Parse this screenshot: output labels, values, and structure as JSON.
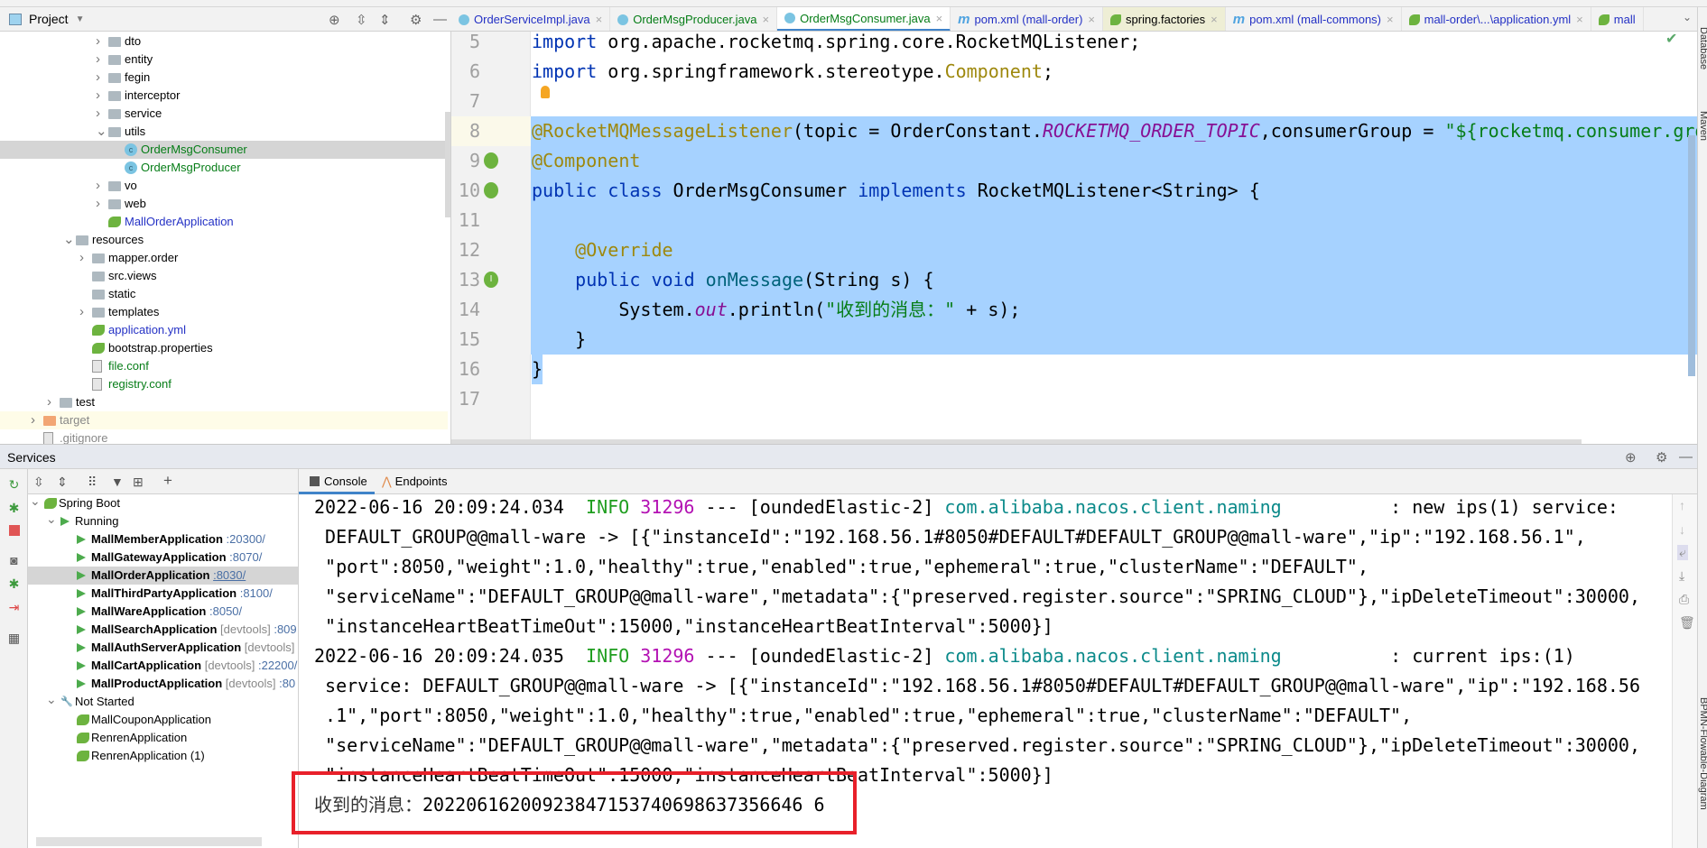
{
  "project": {
    "title": "Project",
    "tree": [
      {
        "label": "dto",
        "icon": "folder-icon",
        "arrow": "›",
        "depth": 6,
        "color": "black"
      },
      {
        "label": "entity",
        "icon": "folder-icon",
        "arrow": "›",
        "depth": 6,
        "color": "black"
      },
      {
        "label": "fegin",
        "icon": "folder-icon",
        "arrow": "›",
        "depth": 6,
        "color": "black"
      },
      {
        "label": "interceptor",
        "icon": "folder-icon",
        "arrow": "›",
        "depth": 6,
        "color": "black"
      },
      {
        "label": "service",
        "icon": "folder-icon",
        "arrow": "›",
        "depth": 6,
        "color": "black"
      },
      {
        "label": "utils",
        "icon": "folder-icon",
        "arrow": "⌄",
        "depth": 6,
        "color": "black"
      },
      {
        "label": "OrderMsgConsumer",
        "icon": "class-icon",
        "arrow": "",
        "depth": 7,
        "color": "green",
        "selected": true
      },
      {
        "label": "OrderMsgProducer",
        "icon": "class-icon",
        "arrow": "",
        "depth": 7,
        "color": "green"
      },
      {
        "label": "vo",
        "icon": "folder-icon",
        "arrow": "›",
        "depth": 6,
        "color": "black"
      },
      {
        "label": "web",
        "icon": "folder-icon",
        "arrow": "›",
        "depth": 6,
        "color": "black"
      },
      {
        "label": "MallOrderApplication",
        "icon": "spring-boot-class-icon",
        "arrow": "",
        "depth": 6,
        "color": "blue"
      },
      {
        "label": "resources",
        "icon": "resources-folder-icon",
        "arrow": "⌄",
        "depth": 4,
        "color": "black"
      },
      {
        "label": "mapper.order",
        "icon": "folder-icon",
        "arrow": "›",
        "depth": 5,
        "color": "black"
      },
      {
        "label": "src.views",
        "icon": "folder-icon",
        "arrow": "",
        "depth": 5,
        "color": "black"
      },
      {
        "label": "static",
        "icon": "folder-icon",
        "arrow": "",
        "depth": 5,
        "color": "black"
      },
      {
        "label": "templates",
        "icon": "folder-icon",
        "arrow": "›",
        "depth": 5,
        "color": "black"
      },
      {
        "label": "application.yml",
        "icon": "spring-config-icon",
        "arrow": "",
        "depth": 5,
        "color": "blue"
      },
      {
        "label": "bootstrap.properties",
        "icon": "spring-config-icon",
        "arrow": "",
        "depth": 5,
        "color": "black"
      },
      {
        "label": "file.conf",
        "icon": "text-file-icon",
        "arrow": "",
        "depth": 5,
        "color": "green"
      },
      {
        "label": "registry.conf",
        "icon": "text-file-icon",
        "arrow": "",
        "depth": 5,
        "color": "green"
      },
      {
        "label": "test",
        "icon": "folder-icon",
        "arrow": "›",
        "depth": 3,
        "color": "black"
      },
      {
        "label": "target",
        "icon": "excluded-folder-icon",
        "arrow": "›",
        "depth": 2,
        "color": "gray",
        "ignored": true
      },
      {
        "label": ".gitignore",
        "icon": "ignore-file-icon",
        "arrow": "",
        "depth": 2,
        "color": "gray"
      }
    ]
  },
  "tabs": [
    {
      "label": "OrderServiceImpl.java",
      "icon": "class-icon",
      "color": "#2431c5"
    },
    {
      "label": "OrderMsgProducer.java",
      "icon": "class-icon",
      "color": "#067d17"
    },
    {
      "label": "OrderMsgConsumer.java",
      "icon": "class-icon",
      "color": "#067d17",
      "active": true
    },
    {
      "label": "pom.xml (mall-order)",
      "icon": "maven-icon",
      "color": "#2431c5"
    },
    {
      "label": "spring.factories",
      "icon": "spring-icon",
      "color": "#000000",
      "highlighted": true
    },
    {
      "label": "pom.xml (mall-commons)",
      "icon": "maven-icon",
      "color": "#2431c5"
    },
    {
      "label": "mall-order\\...\\application.yml",
      "icon": "spring-icon",
      "color": "#2431c5"
    },
    {
      "label": "mall",
      "icon": "spring-icon",
      "color": "#2431c5"
    }
  ],
  "editor": {
    "selection": {
      "from_line": 8,
      "to_line": 16
    },
    "caret_line": 8,
    "lines": [
      {
        "n": "5",
        "tokens": [
          {
            "k": "kw",
            "t": "import"
          },
          {
            "k": "",
            "t": " org.apache.rocketmq.spring.core.RocketMQListener;"
          }
        ]
      },
      {
        "n": "6",
        "tokens": [
          {
            "k": "kw",
            "t": "import"
          },
          {
            "k": "",
            "t": " org.springframework.stereotype."
          },
          {
            "k": "ann",
            "t": "Component"
          },
          {
            "k": "",
            "t": ";"
          }
        ]
      },
      {
        "n": "7",
        "tokens": []
      },
      {
        "n": "8",
        "tokens": [
          {
            "k": "ann",
            "t": "@RocketMQMessageListener"
          },
          {
            "k": "",
            "t": "(topic = OrderConstant."
          },
          {
            "k": "static",
            "t": "ROCKETMQ_ORDER_TOPIC"
          },
          {
            "k": "",
            "t": ",consumerGroup = "
          },
          {
            "k": "str",
            "t": "\"${rocketmq.consumer.gro"
          }
        ]
      },
      {
        "n": "9",
        "tokens": [
          {
            "k": "ann",
            "t": "@Component"
          }
        ],
        "gutter": "spring-bean-icon"
      },
      {
        "n": "10",
        "tokens": [
          {
            "k": "kw",
            "t": "public class"
          },
          {
            "k": "",
            "t": " OrderMsgConsumer "
          },
          {
            "k": "kw",
            "t": "implements"
          },
          {
            "k": "",
            "t": " RocketMQListener<String> {"
          }
        ],
        "gutter": "spring-class-icon"
      },
      {
        "n": "11",
        "tokens": []
      },
      {
        "n": "12",
        "tokens": [
          {
            "k": "",
            "t": "    "
          },
          {
            "k": "ann",
            "t": "@Override"
          }
        ]
      },
      {
        "n": "13",
        "tokens": [
          {
            "k": "",
            "t": "    "
          },
          {
            "k": "kw",
            "t": "public void"
          },
          {
            "k": "",
            "t": " "
          },
          {
            "k": "fn",
            "t": "onMessage"
          },
          {
            "k": "",
            "t": "(String s) {"
          }
        ],
        "gutter": "implements-method-icon"
      },
      {
        "n": "14",
        "tokens": [
          {
            "k": "",
            "t": "        System."
          },
          {
            "k": "static",
            "t": "out"
          },
          {
            "k": "",
            "t": ".println("
          },
          {
            "k": "str",
            "t": "\"收到的消息：\""
          },
          {
            "k": "",
            "t": " + s);"
          }
        ]
      },
      {
        "n": "15",
        "tokens": [
          {
            "k": "",
            "t": "    }"
          }
        ]
      },
      {
        "n": "16",
        "tokens": [
          {
            "k": "",
            "t": "}"
          }
        ]
      },
      {
        "n": "17",
        "tokens": []
      }
    ]
  },
  "right_strip": [
    "Database",
    "Maven",
    "BPMN-Flowable-Diagram"
  ],
  "services": {
    "title": "Services",
    "tree": [
      {
        "label": "Spring Boot",
        "type": "group",
        "depth": 0
      },
      {
        "label": "Running",
        "type": "running-group",
        "depth": 1
      },
      {
        "label": "MallMemberApplication",
        "port": ":20300/",
        "type": "app",
        "depth": 2
      },
      {
        "label": "MallGatewayApplication",
        "port": ":8070/",
        "type": "app",
        "depth": 2
      },
      {
        "label": "MallOrderApplication",
        "port": ":8030/",
        "type": "app",
        "depth": 2,
        "selected": true
      },
      {
        "label": "MallThirdPartyApplication",
        "port": ":8100/",
        "type": "app",
        "depth": 2
      },
      {
        "label": "MallWareApplication",
        "port": ":8050/",
        "type": "app",
        "depth": 2
      },
      {
        "label": "MallSearchApplication",
        "tag": "[devtools]",
        "port": ":809",
        "type": "app",
        "depth": 2
      },
      {
        "label": "MallAuthServerApplication",
        "tag": "[devtools]",
        "type": "app",
        "depth": 2
      },
      {
        "label": "MallCartApplication",
        "tag": "[devtools]",
        "port": ":22200/",
        "type": "app",
        "depth": 2
      },
      {
        "label": "MallProductApplication",
        "tag": "[devtools]",
        "port": ":80",
        "type": "app",
        "depth": 2
      },
      {
        "label": "Not Started",
        "type": "stopped-group",
        "depth": 1
      },
      {
        "label": "MallCouponApplication",
        "type": "idle",
        "depth": 2
      },
      {
        "label": "RenrenApplication",
        "type": "idle",
        "depth": 2
      },
      {
        "label": "RenrenApplication (1)",
        "type": "idle",
        "depth": 2
      }
    ]
  },
  "console": {
    "tabs": [
      {
        "label": "Console"
      },
      {
        "label": "Endpoints"
      }
    ],
    "lines": [
      [
        {
          "k": "",
          "t": "2022-06-16 20:09:24.034  "
        },
        {
          "k": "info",
          "t": "INFO"
        },
        {
          "k": "",
          "t": " "
        },
        {
          "k": "pid",
          "t": "31296"
        },
        {
          "k": "",
          "t": " --- [oundedElastic-2] "
        },
        {
          "k": "logger",
          "t": "com.alibaba.nacos.client.naming"
        },
        {
          "k": "",
          "t": "          : new ips(1) service:"
        }
      ],
      [
        {
          "k": "",
          "t": " DEFAULT_GROUP@@mall-ware -> [{\"instanceId\":\"192.168.56.1#8050#DEFAULT#DEFAULT_GROUP@@mall-ware\",\"ip\":\"192.168.56.1\","
        }
      ],
      [
        {
          "k": "",
          "t": " \"port\":8050,\"weight\":1.0,\"healthy\":true,\"enabled\":true,\"ephemeral\":true,\"clusterName\":\"DEFAULT\","
        }
      ],
      [
        {
          "k": "",
          "t": " \"serviceName\":\"DEFAULT_GROUP@@mall-ware\",\"metadata\":{\"preserved.register.source\":\"SPRING_CLOUD\"},\"ipDeleteTimeout\":30000,"
        }
      ],
      [
        {
          "k": "",
          "t": " \"instanceHeartBeatTimeOut\":15000,\"instanceHeartBeatInterval\":5000}]"
        }
      ],
      [
        {
          "k": "",
          "t": "2022-06-16 20:09:24.035  "
        },
        {
          "k": "info",
          "t": "INFO"
        },
        {
          "k": "",
          "t": " "
        },
        {
          "k": "pid",
          "t": "31296"
        },
        {
          "k": "",
          "t": " --- [oundedElastic-2] "
        },
        {
          "k": "logger",
          "t": "com.alibaba.nacos.client.naming"
        },
        {
          "k": "",
          "t": "          : current ips:(1)"
        }
      ],
      [
        {
          "k": "",
          "t": " service: DEFAULT_GROUP@@mall-ware -> [{\"instanceId\":\"192.168.56.1#8050#DEFAULT#DEFAULT_GROUP@@mall-ware\",\"ip\":\"192.168.56"
        }
      ],
      [
        {
          "k": "",
          "t": " .1\",\"port\":8050,\"weight\":1.0,\"healthy\":true,\"enabled\":true,\"ephemeral\":true,\"clusterName\":\"DEFAULT\","
        }
      ],
      [
        {
          "k": "",
          "t": " \"serviceName\":\"DEFAULT_GROUP@@mall-ware\",\"metadata\":{\"preserved.register.source\":\"SPRING_CLOUD\"},\"ipDeleteTimeout\":30000,"
        }
      ],
      [
        {
          "k": "",
          "t": " \"instanceHeartBeatTimeOut\":15000,\"instanceHeartBeatInterval\":5000}]"
        }
      ],
      [
        {
          "k": "cjk",
          "t": "收到的消息："
        },
        {
          "k": "",
          "t": "20220616200923847153740698637356646 6"
        }
      ]
    ]
  },
  "colors": {
    "selection": "#a6d2ff",
    "accent": "#4083c9",
    "highlight_box": "#e8202a",
    "run_green": "#4dab4d"
  }
}
